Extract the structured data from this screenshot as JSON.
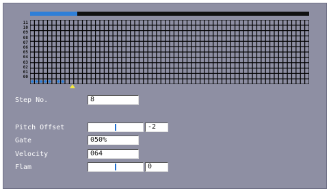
{
  "sequencer": {
    "progress": 0.17,
    "row_labels": [
      "11",
      "10",
      "09",
      "08",
      "07",
      "06",
      "05",
      "04",
      "03",
      "02",
      "01",
      "00"
    ],
    "columns": 64,
    "rows": 12,
    "active_steps_row00": [
      0,
      1,
      2,
      3,
      4,
      6,
      7
    ],
    "accent_color": "#2f7fd8",
    "playhead_color": "#f4e840"
  },
  "fields": {
    "step_no": {
      "label": "Step No.",
      "value": "8"
    },
    "pitch_offset": {
      "label": "Pitch Offset",
      "value": "-2",
      "slider_fraction": 0.5
    },
    "gate": {
      "label": "Gate",
      "value": "050%"
    },
    "velocity": {
      "label": "Velocity",
      "value": "064"
    },
    "flam": {
      "label": "Flam",
      "value": "0",
      "slider_fraction": 0.5
    }
  }
}
